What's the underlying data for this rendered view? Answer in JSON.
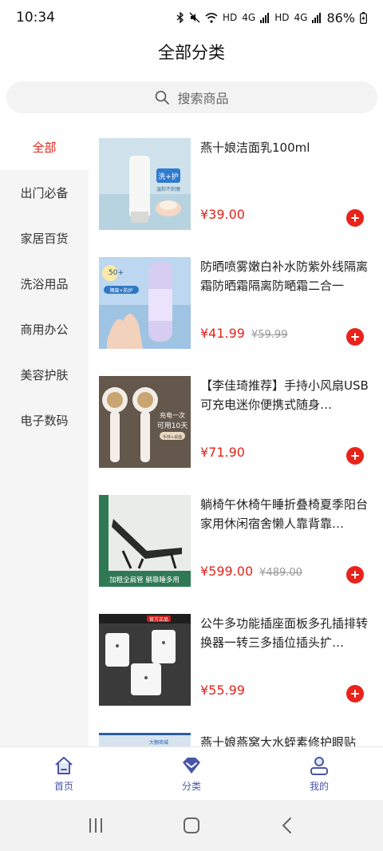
{
  "status_bar": {
    "time": "10:34",
    "network_labels": [
      "HD",
      "4G",
      "HD",
      "4G"
    ],
    "battery": "86%"
  },
  "header": {
    "title": "全部分类"
  },
  "search": {
    "placeholder": "搜索商品"
  },
  "sidebar": {
    "items": [
      {
        "label": "全部",
        "active": true
      },
      {
        "label": "出门必备"
      },
      {
        "label": "家居百货"
      },
      {
        "label": "洗浴用品"
      },
      {
        "label": "商用办公"
      },
      {
        "label": "美容护肤"
      },
      {
        "label": "电子数码"
      }
    ]
  },
  "products": [
    {
      "name": "燕十娘洁面乳100ml",
      "price": "¥39.00",
      "original_price": ""
    },
    {
      "name": "防晒喷雾嫩白补水防紫外线隔离霜防晒霜隔离防嗮霜二合一",
      "price": "¥41.99",
      "original_price": "¥59.99"
    },
    {
      "name": "【李佳琦推荐】手持小风扇USB可充电迷你便携式随身…",
      "price": "¥71.90",
      "original_price": ""
    },
    {
      "name": "躺椅午休椅午睡折叠椅夏季阳台家用休闲宿舍懒人靠背靠…",
      "price": "¥599.00",
      "original_price": "¥489.00"
    },
    {
      "name": "公牛多功能插座面板多孔插排转换器一转三多插位插头扩…",
      "price": "¥55.99",
      "original_price": ""
    },
    {
      "name": "燕十娘燕窝大水蛭素修护眼贴",
      "price": "",
      "original_price": ""
    }
  ],
  "product_image_texts": {
    "p1_badge": "洗+护",
    "p1_sub": "温和不刺激",
    "p2_spf": "50+",
    "p2_tag": "隔离+防护",
    "p3_line1": "充电一次",
    "p3_line2": "可用10天",
    "p3_tag": "手持+桌面",
    "p4_strip": "加粗全扁管 躺靠睡多用",
    "p5_tag": "官方正品",
    "p6_tag": "大额商城"
  },
  "tab_bar": {
    "home_label": "首页",
    "category_label": "分类",
    "mine_label": "我的"
  },
  "colors": {
    "accent_red": "#e0261b",
    "tab_purple": "#4a55a8",
    "sidebar_bg": "#f5f5f5"
  }
}
